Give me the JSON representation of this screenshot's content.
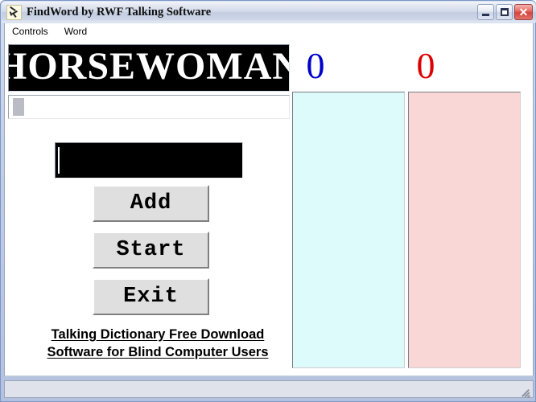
{
  "window": {
    "title": "FindWord by RWF Talking Software",
    "icon": "app-runner-icon",
    "controls": {
      "minimize": "Minimize",
      "maximize": "Maximize",
      "close": "Close"
    }
  },
  "menubar": {
    "items": [
      {
        "label": "Controls"
      },
      {
        "label": "Word"
      }
    ]
  },
  "main": {
    "word_banner": {
      "text": "HORSEWOMAN",
      "background": "#000000",
      "color": "#ffffff"
    },
    "sub_panel": {
      "placeholder_chip": "",
      "chip_color": "#b9bcc4"
    },
    "word_input": {
      "value": "",
      "placeholder": "",
      "background": "#000000",
      "caret_color": "#ffffff"
    },
    "buttons": [
      {
        "label": "Add"
      },
      {
        "label": "Start"
      },
      {
        "label": "Exit"
      }
    ],
    "promo_link": {
      "line1": "Talking Dictionary Free Download",
      "line2": "Software for Blind Computer Users",
      "color": "#000000"
    }
  },
  "scores": [
    {
      "id": "player-one",
      "value": "0",
      "value_color": "#0000cc",
      "box_color": "#ddfbfb",
      "items": []
    },
    {
      "id": "player-two",
      "value": "0",
      "value_color": "#dd0000",
      "box_color": "#f9d7d7",
      "items": []
    }
  ],
  "statusbar": {
    "text": "",
    "resize_grip": "resize-grip"
  }
}
